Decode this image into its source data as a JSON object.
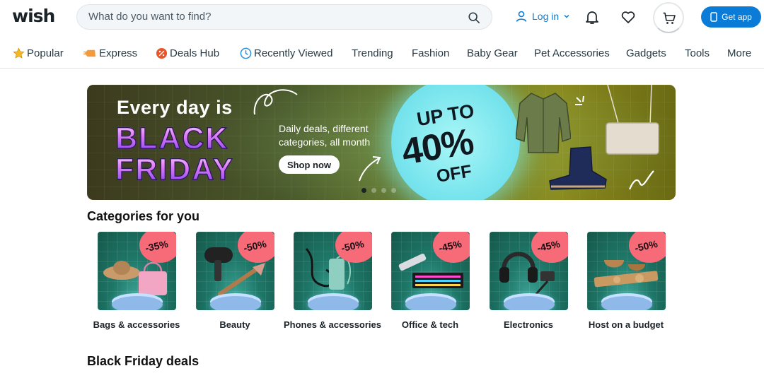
{
  "header": {
    "logo": "wish",
    "search_placeholder": "What do you want to find?",
    "login_label": "Log in",
    "get_app_label": "Get app"
  },
  "nav": [
    {
      "label": "Popular",
      "icon": "star-icon"
    },
    {
      "label": "Express",
      "icon": "express-icon"
    },
    {
      "label": "Deals Hub",
      "icon": "deals-icon"
    },
    {
      "label": "Recently Viewed",
      "icon": "clock-icon"
    },
    {
      "label": "Trending"
    },
    {
      "label": "Fashion"
    },
    {
      "label": "Baby Gear"
    },
    {
      "label": "Pet Accessories"
    },
    {
      "label": "Gadgets"
    },
    {
      "label": "Tools"
    },
    {
      "label": "More"
    }
  ],
  "banner": {
    "line1": "Every day is",
    "line2": "BLACK",
    "line3": "FRIDAY",
    "subtitle": "Daily deals, different categories, all month",
    "cta": "Shop now",
    "promo_line1": "UP TO",
    "promo_line2": "40%",
    "promo_line3": "OFF"
  },
  "categories_title": "Categories for you",
  "categories": [
    {
      "label": "Bags & accessories",
      "discount": "-35%"
    },
    {
      "label": "Beauty",
      "discount": "-50%"
    },
    {
      "label": "Phones & accessories",
      "discount": "-50%"
    },
    {
      "label": "Office & tech",
      "discount": "-45%"
    },
    {
      "label": "Electronics",
      "discount": "-45%"
    },
    {
      "label": "Host on a budget",
      "discount": "-50%"
    }
  ],
  "deals_title": "Black Friday deals",
  "colors": {
    "accent": "#0a7bd6",
    "discount_badge": "#f76a78"
  }
}
